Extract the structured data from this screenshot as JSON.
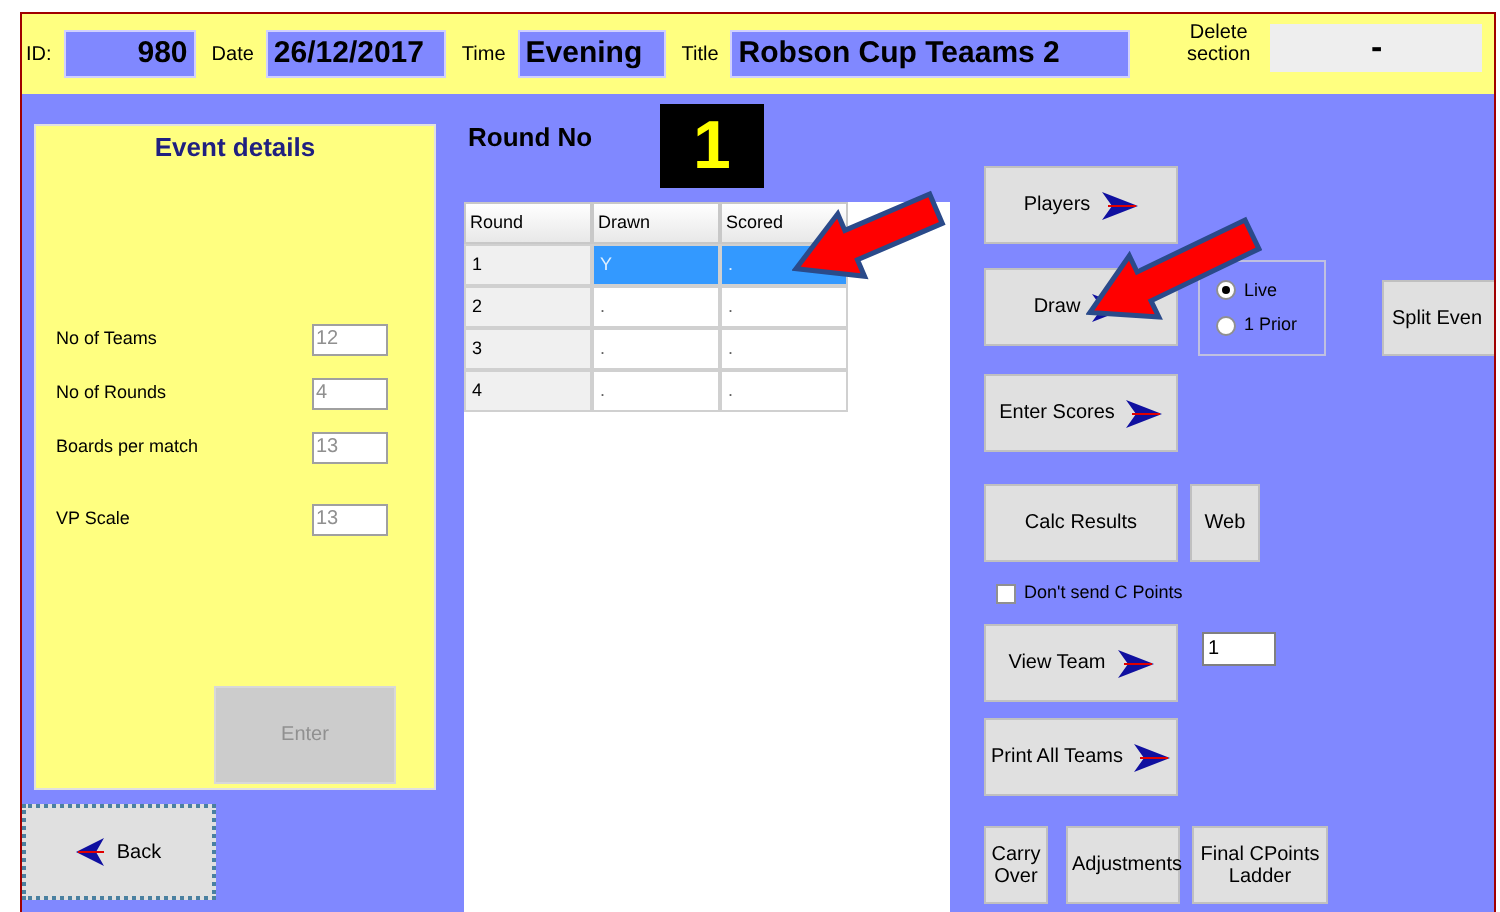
{
  "header": {
    "fields": [
      {
        "label": "ID:",
        "value": "980"
      },
      {
        "label": "Date",
        "value": "26/12/2017"
      },
      {
        "label": "Time",
        "value": "Evening"
      },
      {
        "label": "Title",
        "value": "Robson Cup Teaams 2"
      }
    ],
    "delete_section": {
      "label": "Delete section",
      "value": "-"
    }
  },
  "event_details": {
    "title": "Event details",
    "fields": [
      {
        "label": "No of Teams",
        "value": "12",
        "disabled": true
      },
      {
        "label": "No of Rounds",
        "value": "4",
        "disabled": true
      },
      {
        "label": "Boards per match",
        "value": "13",
        "disabled": true
      },
      {
        "label": "VP Scale",
        "value": "13",
        "disabled": true
      }
    ],
    "enter_button": {
      "label": "Enter",
      "disabled": true
    }
  },
  "back_button": {
    "label": "Back"
  },
  "round_no": {
    "label": "Round No",
    "value": "1"
  },
  "table": {
    "columns": [
      "Round",
      "Drawn",
      "Scored"
    ],
    "rows": [
      {
        "cells": [
          "1",
          "Y",
          "."
        ],
        "selected": true
      },
      {
        "cells": [
          "2",
          ".",
          "."
        ],
        "selected": false
      },
      {
        "cells": [
          "3",
          ".",
          "."
        ],
        "selected": false
      },
      {
        "cells": [
          "4",
          ".",
          "."
        ],
        "selected": false
      }
    ]
  },
  "actions": {
    "players": {
      "label": "Players",
      "arrow": true
    },
    "draw": {
      "label": "Draw",
      "arrow": true
    },
    "draw_options": [
      {
        "label": "Live",
        "selected": true
      },
      {
        "label": "1 Prior",
        "selected": false
      }
    ],
    "split_event": {
      "label": "Split Even"
    },
    "enter_scores": {
      "label": "Enter Scores",
      "arrow": true
    },
    "calc_results": {
      "label": "Calc Results",
      "arrow": false
    },
    "web": {
      "label": "Web"
    },
    "dont_send": {
      "label": "Don't send C Points",
      "checked": false
    },
    "view_team": {
      "label": "View Team",
      "arrow": true
    },
    "team_number": {
      "value": "1"
    },
    "print_all": {
      "label": "Print All Teams",
      "arrow": true
    },
    "bottom_buttons": [
      {
        "label": "Carry Over"
      },
      {
        "label": "Adjustments"
      },
      {
        "label": "Final CPoints Ladder"
      }
    ]
  }
}
